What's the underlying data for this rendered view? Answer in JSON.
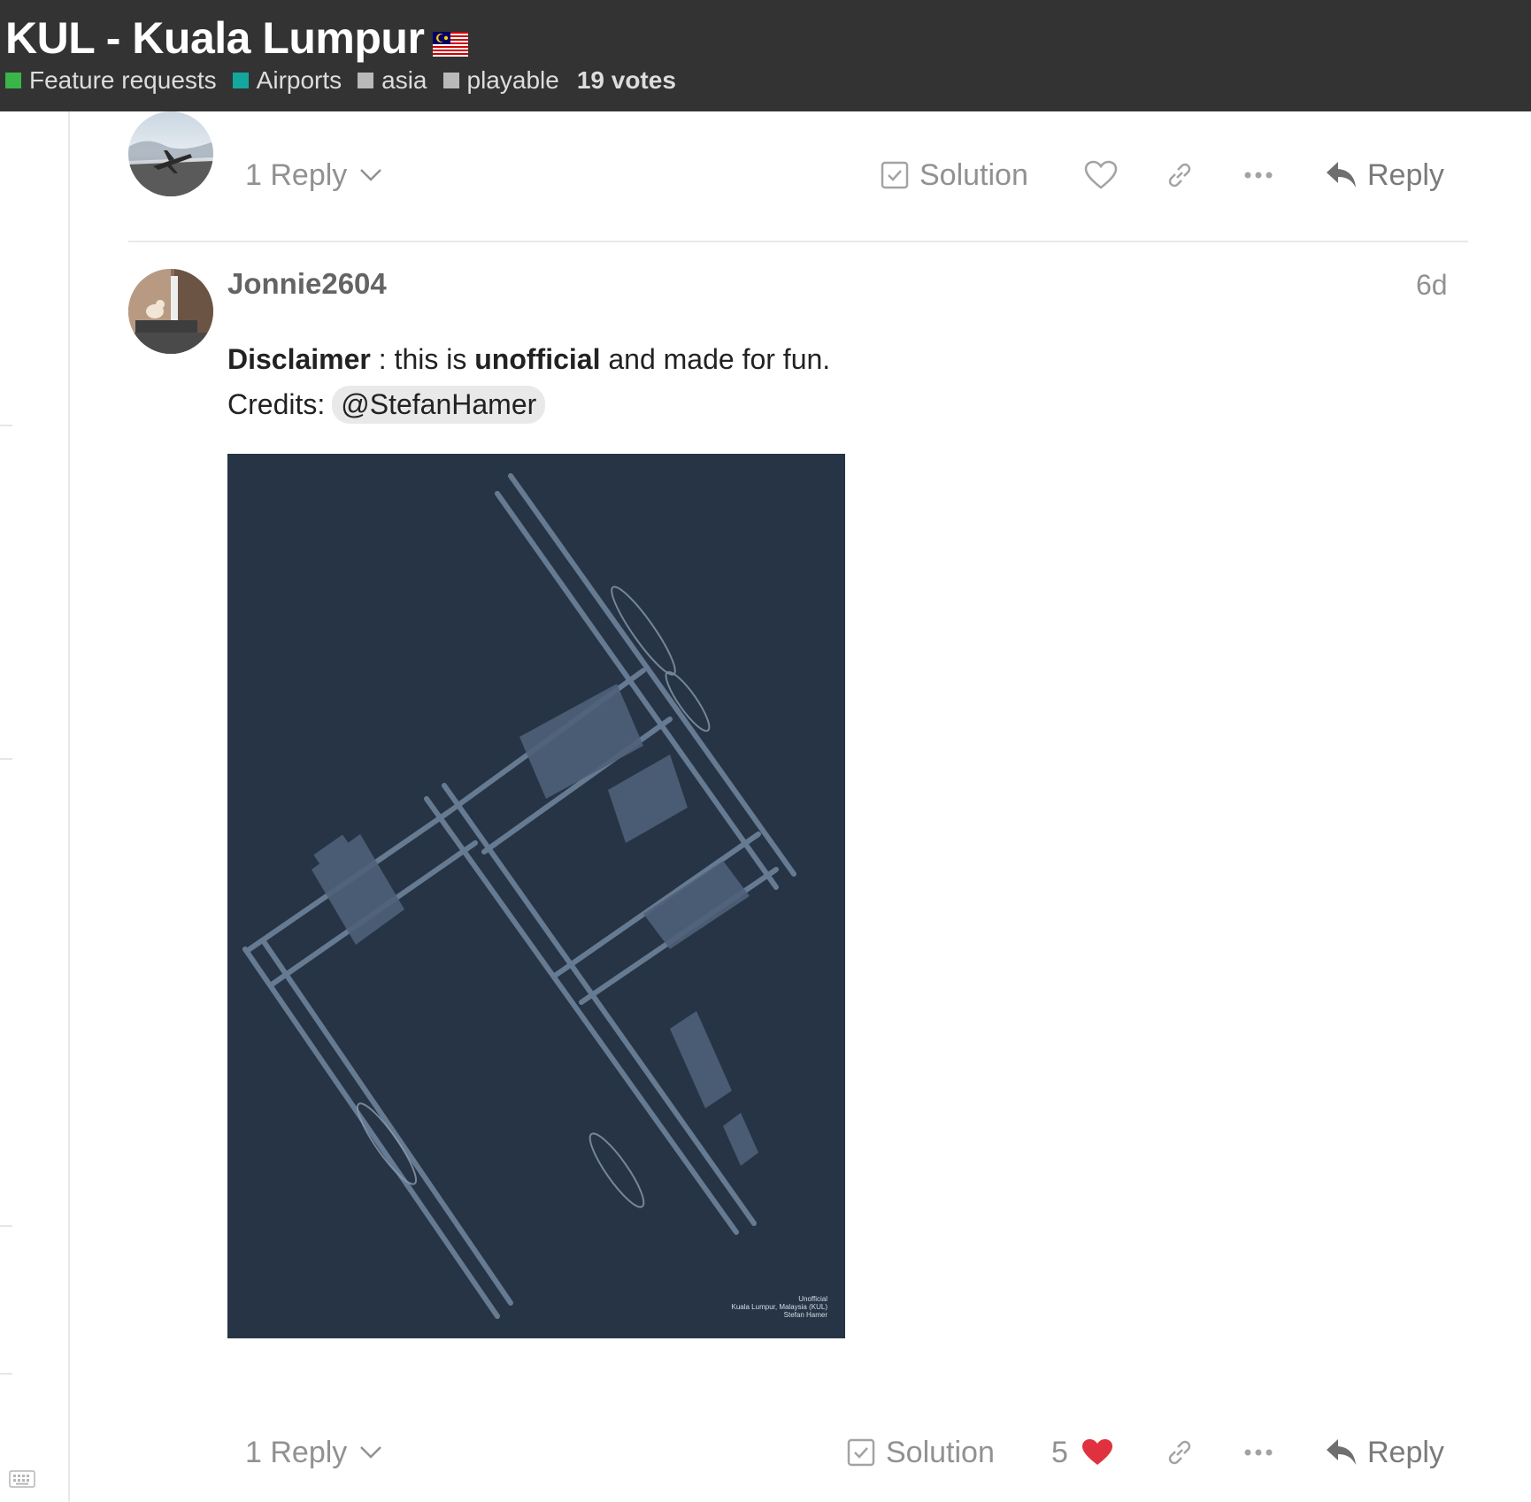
{
  "topic": {
    "title": "KUL - Kuala Lumpur",
    "flag_icon": "malaysia-flag-icon",
    "tags": [
      {
        "label": "Feature requests",
        "color": "#3ab54a"
      },
      {
        "label": "Airports",
        "color": "#12a89d"
      },
      {
        "label": "asia",
        "color": "#b9b9b9"
      },
      {
        "label": "playable",
        "color": "#b9b9b9"
      }
    ],
    "votes": "19 votes"
  },
  "post1": {
    "replies_label": "1 Reply",
    "solution_label": "Solution",
    "reply_label": "Reply"
  },
  "post2": {
    "username": "Jonnie2604",
    "age": "6d",
    "disclaimer_bold": "Disclaimer",
    "disclaimer_rest": " : this is ",
    "unofficial_bold": "unofficial",
    "disclaimer_end": " and made for fun.",
    "credits_label": "Credits:",
    "mention": "@StefanHamer",
    "image": {
      "caption_line1": "Unofficial",
      "caption_line2": "Kuala Lumpur, Malaysia (KUL)",
      "caption_line3": "Stefan Hamer",
      "background": "#263445",
      "line_color": "#6e829b"
    },
    "replies_label": "1 Reply",
    "solution_label": "Solution",
    "like_count": "5",
    "reply_label": "Reply"
  }
}
